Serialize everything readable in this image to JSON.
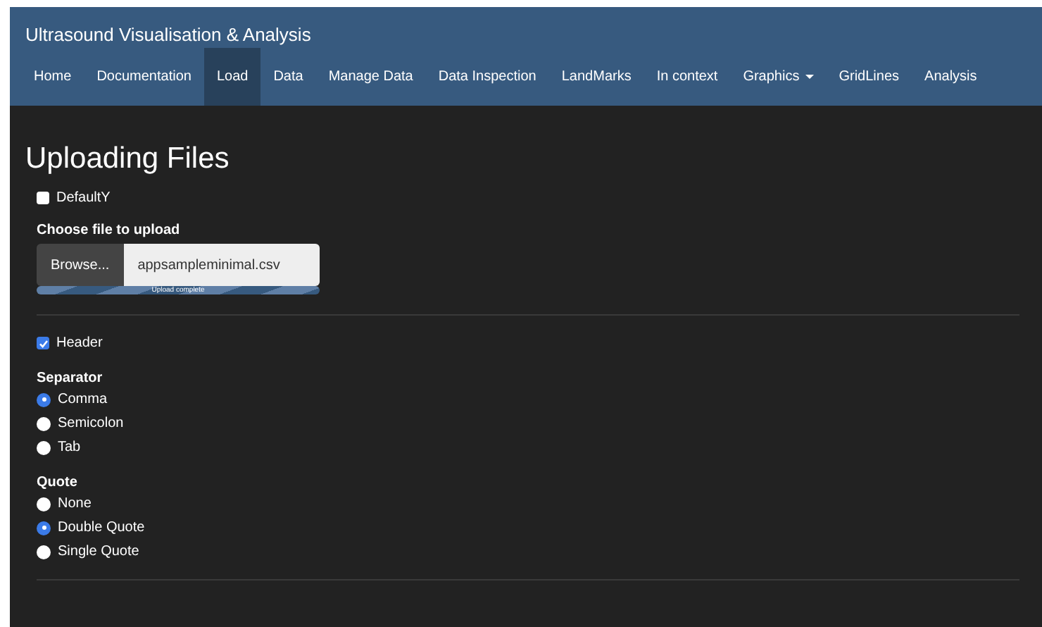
{
  "app_title": "Ultrasound Visualisation & Analysis",
  "nav": [
    {
      "label": "Home",
      "selected": false,
      "dropdown": false
    },
    {
      "label": "Documentation",
      "selected": false,
      "dropdown": false
    },
    {
      "label": "Load",
      "selected": true,
      "dropdown": false
    },
    {
      "label": "Data",
      "selected": false,
      "dropdown": false
    },
    {
      "label": "Manage Data",
      "selected": false,
      "dropdown": false
    },
    {
      "label": "Data Inspection",
      "selected": false,
      "dropdown": false
    },
    {
      "label": "LandMarks",
      "selected": false,
      "dropdown": false
    },
    {
      "label": "In context",
      "selected": false,
      "dropdown": false
    },
    {
      "label": "Graphics",
      "selected": false,
      "dropdown": true
    },
    {
      "label": "GridLines",
      "selected": false,
      "dropdown": false
    },
    {
      "label": "Analysis",
      "selected": false,
      "dropdown": false
    }
  ],
  "heading": "Uploading Files",
  "default_y": {
    "label": "DefaultY",
    "checked": false
  },
  "file_upload": {
    "label": "Choose file to upload",
    "button": "Browse...",
    "value": "appsampleminimal.csv",
    "progress_text": "Upload complete",
    "level": 1
  },
  "header": {
    "label": "Header",
    "checked": true
  },
  "separator": {
    "label": "Separator",
    "options": [
      {
        "label": "Comma",
        "selected": true
      },
      {
        "label": "Semicolon",
        "selected": false
      },
      {
        "label": "Tab",
        "selected": false
      }
    ]
  },
  "quote": {
    "label": "Quote",
    "options": [
      {
        "label": "None",
        "selected": false
      },
      {
        "label": "Double Quote",
        "selected": true
      },
      {
        "label": "Single Quote",
        "selected": false
      }
    ]
  }
}
